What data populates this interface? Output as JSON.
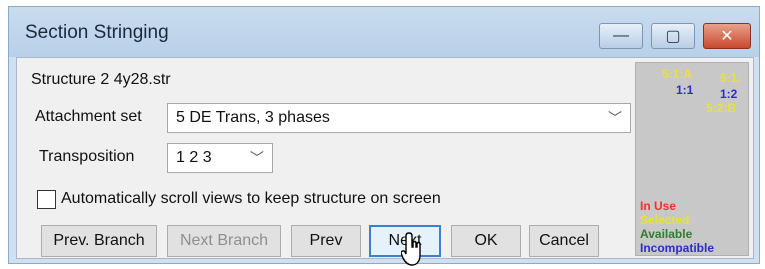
{
  "window": {
    "title": "Section Stringing"
  },
  "titlebar_buttons": {
    "minimize": "—",
    "maximize": "▢",
    "close": "✕"
  },
  "structure_file": "Structure 2 4y28.str",
  "attachment_set": {
    "label": "Attachment set",
    "value": "5  DE Trans, 3 phases"
  },
  "transposition": {
    "label": "Transposition",
    "value": "1 2 3"
  },
  "auto_scroll": {
    "label": "Automatically scroll views to keep structure on screen",
    "checked": false
  },
  "buttons": {
    "prev_branch": "Prev. Branch",
    "next_branch": "Next Branch",
    "prev": "Prev",
    "next": "Next",
    "ok": "OK",
    "cancel": "Cancel"
  },
  "preview": {
    "labels": {
      "l1": "5:1:A",
      "l2": "1:1",
      "l3": "1:2",
      "l4": "5:1:",
      "l5": "5:2:B"
    },
    "legend": [
      "In Use",
      "Selected",
      "Available",
      "Incompatible"
    ],
    "colors": {
      "in_use": "#ff2a2a",
      "selected": "#e8e23a",
      "available": "#2f7d2f",
      "incompatible": "#2b2bd1"
    }
  }
}
